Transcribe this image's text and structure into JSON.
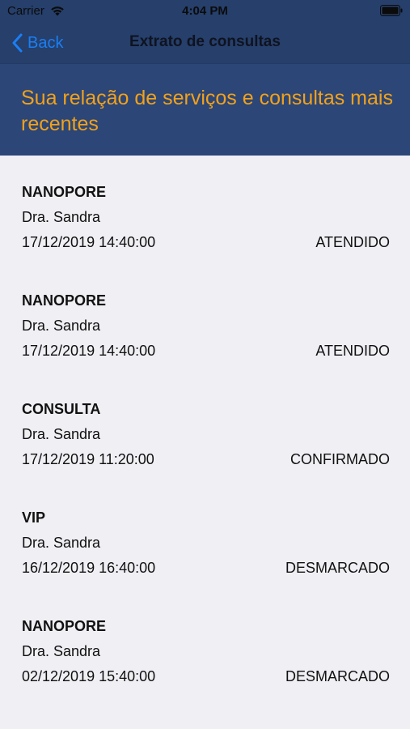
{
  "status_bar": {
    "carrier": "Carrier",
    "time": "4:04 PM",
    "wifi_icon": "wifi-icon",
    "battery_icon": "battery-icon"
  },
  "nav": {
    "back_label": "Back",
    "back_icon": "chevron-left-icon",
    "title": "Extrato de consultas"
  },
  "header": {
    "text": "Sua relação de serviços e consultas mais recentes"
  },
  "colors": {
    "nav_background": "#263f6b",
    "header_background": "#2b4677",
    "header_text": "#f2a11b",
    "back_accent": "#1a7ff5",
    "list_background": "#efeff4"
  },
  "items": [
    {
      "service": "NANOPORE",
      "doctor": "Dra. Sandra",
      "datetime": "17/12/2019 14:40:00",
      "status": "ATENDIDO"
    },
    {
      "service": "NANOPORE",
      "doctor": "Dra. Sandra",
      "datetime": "17/12/2019 14:40:00",
      "status": "ATENDIDO"
    },
    {
      "service": "CONSULTA",
      "doctor": "Dra. Sandra",
      "datetime": "17/12/2019 11:20:00",
      "status": "CONFIRMADO"
    },
    {
      "service": "VIP",
      "doctor": "Dra. Sandra",
      "datetime": "16/12/2019 16:40:00",
      "status": "DESMARCADO"
    },
    {
      "service": "NANOPORE",
      "doctor": "Dra. Sandra",
      "datetime": "02/12/2019 15:40:00",
      "status": "DESMARCADO"
    }
  ]
}
